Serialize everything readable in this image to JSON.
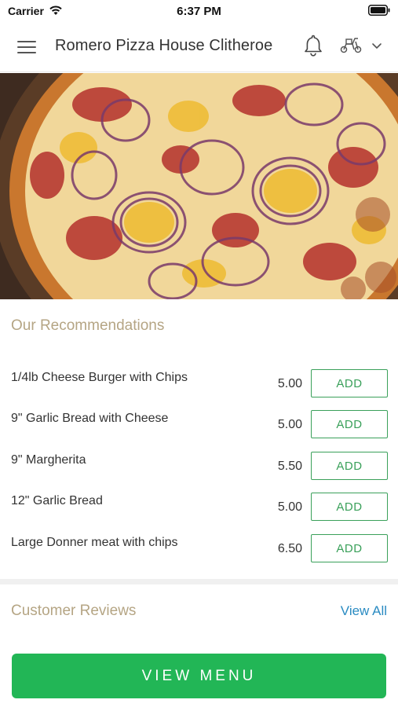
{
  "status_bar": {
    "carrier": "Carrier",
    "time": "6:37 PM"
  },
  "header": {
    "title": "Romero Pizza House Clitheroe"
  },
  "icons": {
    "menu": "hamburger-menu-icon",
    "notifications": "bell-icon",
    "order_mode": "delivery-scooter-icon",
    "order_mode_dropdown": "chevron-down-icon"
  },
  "recommendations": {
    "title": "Our Recommendations",
    "items": [
      {
        "name": "1/4lb Cheese Burger with Chips",
        "price": "5.00",
        "button": "ADD"
      },
      {
        "name": "9\" Garlic Bread with Cheese",
        "price": "5.00",
        "button": "ADD"
      },
      {
        "name": "9\" Margherita",
        "price": "5.50",
        "button": "ADD"
      },
      {
        "name": "12\" Garlic Bread",
        "price": "5.00",
        "button": "ADD"
      },
      {
        "name": "Large Donner meat with chips",
        "price": "6.50",
        "button": "ADD"
      }
    ]
  },
  "reviews": {
    "title": "Customer Reviews",
    "view_all": "View All"
  },
  "view_menu_button": "VIEW MENU",
  "colors": {
    "accent_green": "#22b656",
    "add_button_green": "#3aa05a",
    "section_title": "#b5a584",
    "link_blue": "#2a8bc2"
  }
}
